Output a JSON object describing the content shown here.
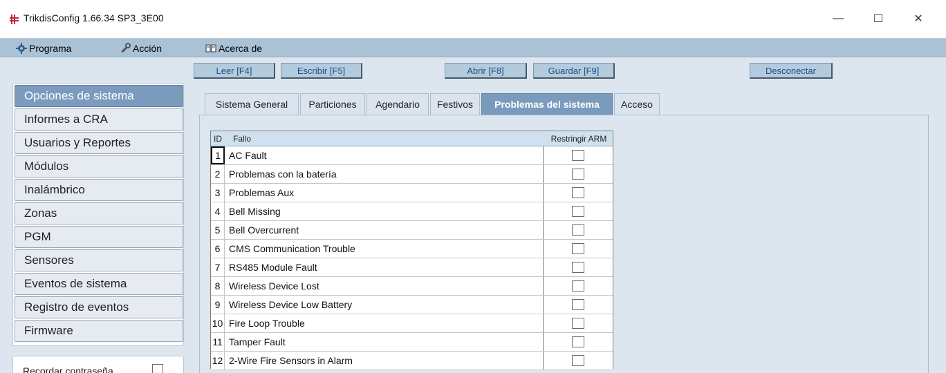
{
  "window": {
    "title": "TrikdisConfig 1.66.34    SP3_3E00",
    "min_glyph": "—",
    "max_glyph": "☐",
    "close_glyph": "✕"
  },
  "menu": {
    "items": [
      {
        "label": "Programa",
        "icon": "gear-icon"
      },
      {
        "label": "Acción",
        "icon": "wrench-icon"
      },
      {
        "label": "Acerca de",
        "icon": "book-icon"
      }
    ]
  },
  "toolbar": {
    "read": "Leer [F4]",
    "write": "Escribir [F5]",
    "open": "Abrir [F8]",
    "save": "Guardar [F9]",
    "disconnect": "Desconectar"
  },
  "sidebar": {
    "items": [
      {
        "label": "Opciones de sistema"
      },
      {
        "label": "Informes a CRA"
      },
      {
        "label": "Usuarios y Reportes"
      },
      {
        "label": "Módulos"
      },
      {
        "label": "Inalámbrico"
      },
      {
        "label": "Zonas"
      },
      {
        "label": "PGM"
      },
      {
        "label": "Sensores"
      },
      {
        "label": "Eventos de sistema"
      },
      {
        "label": "Registro de eventos"
      },
      {
        "label": "Firmware"
      }
    ],
    "remember_password": "Recordar contraseña"
  },
  "tabs": [
    {
      "label": "Sistema General"
    },
    {
      "label": "Particiones"
    },
    {
      "label": "Agendario"
    },
    {
      "label": "Festivos"
    },
    {
      "label": "Problemas del sistema"
    },
    {
      "label": "Acceso"
    }
  ],
  "grid": {
    "headers": {
      "id": "ID",
      "fault": "Fallo",
      "restrict": "Restringir ARM"
    },
    "rows": [
      {
        "id": "1",
        "fault": "AC Fault",
        "checked": false
      },
      {
        "id": "2",
        "fault": "Problemas con la batería",
        "checked": false
      },
      {
        "id": "3",
        "fault": "Problemas Aux",
        "checked": false
      },
      {
        "id": "4",
        "fault": "Bell Missing",
        "checked": false
      },
      {
        "id": "5",
        "fault": "Bell Overcurrent",
        "checked": false
      },
      {
        "id": "6",
        "fault": "CMS Communication Trouble",
        "checked": false
      },
      {
        "id": "7",
        "fault": "RS485 Module Fault",
        "checked": false
      },
      {
        "id": "8",
        "fault": "Wireless Device Lost",
        "checked": false
      },
      {
        "id": "9",
        "fault": "Wireless Device Low Battery",
        "checked": false
      },
      {
        "id": "10",
        "fault": "Fire Loop Trouble",
        "checked": false
      },
      {
        "id": "11",
        "fault": "Tamper Fault",
        "checked": false
      },
      {
        "id": "12",
        "fault": "2-Wire Fire Sensors in Alarm",
        "checked": false
      }
    ]
  },
  "colors": {
    "menubar": "#a9c2d6",
    "active_nav": "#7a9bbd",
    "toolbar_text": "#1f4e86",
    "header_bg": "#cfe0ef"
  }
}
